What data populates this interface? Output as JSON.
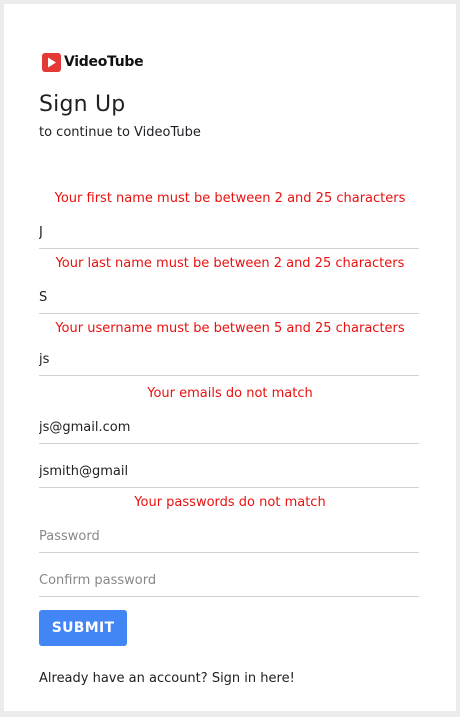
{
  "brand": {
    "name": "VideoTube",
    "icon": "play-icon",
    "icon_color": "#e53935"
  },
  "heading": {
    "title": "Sign Up",
    "subtitle": "to continue to VideoTube"
  },
  "errors": {
    "first_name": "Your first name must be between 2 and 25 characters",
    "last_name": "Your last name must be between 2 and 25 characters",
    "username": "Your username must be between 5 and 25 characters",
    "email": "Your emails do not match",
    "password": "Your passwords do not match"
  },
  "fields": {
    "first_name": {
      "value": "J"
    },
    "last_name": {
      "value": "S"
    },
    "username": {
      "value": "js"
    },
    "email": {
      "value": "js@gmail.com"
    },
    "email_confirm": {
      "value": "jsmith@gmail"
    },
    "password": {
      "value": "",
      "placeholder": "Password"
    },
    "password_confirm": {
      "value": "",
      "placeholder": "Confirm password"
    }
  },
  "submit": {
    "label": "SUBMIT",
    "color": "#4285f4"
  },
  "signin": {
    "prompt": "Already have an account?",
    "link": "Sign in here!"
  },
  "colors": {
    "error": "#e8110f"
  }
}
